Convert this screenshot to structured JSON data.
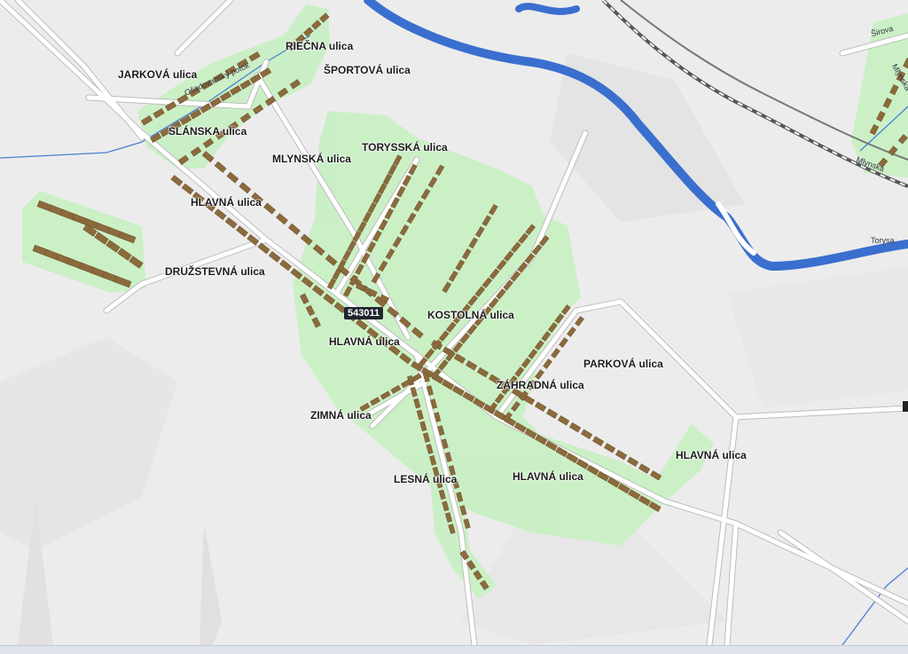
{
  "map": {
    "code_badge": "543011",
    "colors": {
      "background": "#ececec",
      "intravilan": "#c9f0c4",
      "building": "#8b6a3c",
      "river": "#3a6fcf",
      "road": "#ffffff",
      "railway": "#555555"
    },
    "streets": {
      "jarkova": "JARKOVÁ ulica",
      "riecna": "RIEČNA ulica",
      "sportova": "ŠPORTOVÁ ulica",
      "slanska": "SLÁNSKA ulica",
      "torysska": "TORYSSKÁ ulica",
      "mlynska": "MLYNSKÁ ulica",
      "hlavna_1": "HLAVNÁ ulica",
      "druzstevna": "DRUŽSTEVNÁ ulica",
      "kostolna": "KOSTOLNÁ ulica",
      "hlavna_2": "HLAVNÁ ulica",
      "parkova": "PARKOVÁ ulica",
      "zahradna": "ZÁHRADNÁ ulica",
      "zimna": "ZIMNÁ ulica",
      "hlavna_3": "HLAVNÁ ulica",
      "lesna": "LESNÁ ulica",
      "hlavna_4": "HLAVNÁ ulica"
    },
    "minor_labels": {
      "osadovansky_potok": "Ošadovanský potok",
      "torysa": "Torysa",
      "sirova": "Širova",
      "mlynska_1": "Mlynská",
      "mlynska_2": "Mlynská"
    }
  }
}
